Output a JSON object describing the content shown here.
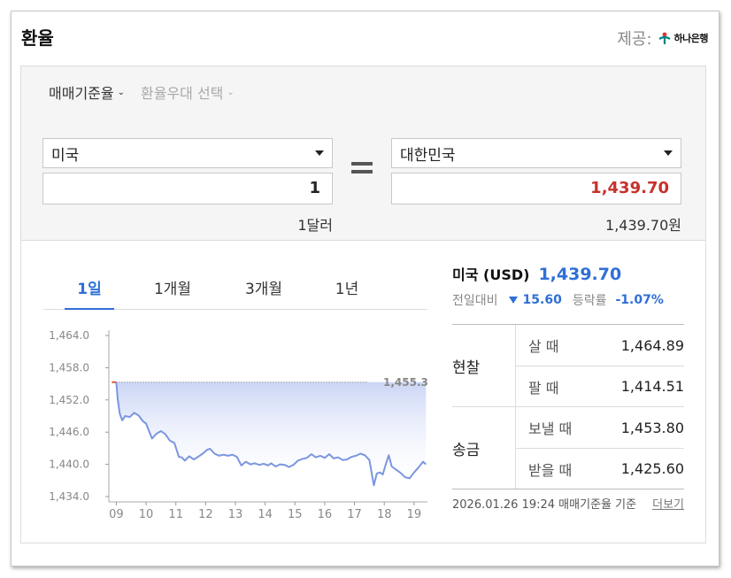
{
  "header": {
    "title": "환율",
    "provider_label": "제공:",
    "provider_name": "하나은행"
  },
  "filters": [
    {
      "label": "매매기준율",
      "active": true
    },
    {
      "label": "환율우대 선택",
      "active": false
    }
  ],
  "converter": {
    "from_country": "미국",
    "from_amount": "1",
    "from_unit_text": "1달러",
    "to_country": "대한민국",
    "to_amount": "1,439.70",
    "to_unit_text": "1,439.70원"
  },
  "tabs": [
    {
      "label": "1일",
      "active": true
    },
    {
      "label": "1개월",
      "active": false
    },
    {
      "label": "3개월",
      "active": false
    },
    {
      "label": "1년",
      "active": false
    }
  ],
  "current": {
    "name": "미국 (USD)",
    "value": "1,439.70",
    "prev_label": "전일대비",
    "change": "15.60",
    "rate_label": "등락률",
    "rate": "-1.07%"
  },
  "rates": [
    {
      "group": "현찰",
      "rows": [
        {
          "label": "살 때",
          "value": "1,464.89"
        },
        {
          "label": "팔 때",
          "value": "1,414.51"
        }
      ]
    },
    {
      "group": "송금",
      "rows": [
        {
          "label": "보낼 때",
          "value": "1,453.80"
        },
        {
          "label": "받을 때",
          "value": "1,425.60"
        }
      ]
    }
  ],
  "footer": {
    "timestamp": "2026.01.26 19:24",
    "basis": "매매기준율 기준",
    "more_label": "더보기"
  },
  "chart_data": {
    "type": "area",
    "ylim": [
      1434.0,
      1464.0
    ],
    "y_ticks": [
      "1,464.0",
      "1,458.0",
      "1,452.0",
      "1,446.0",
      "1,440.0",
      "1,434.0"
    ],
    "x_ticks": [
      "09",
      "10",
      "11",
      "12",
      "13",
      "14",
      "15",
      "16",
      "17",
      "18",
      "19"
    ],
    "reference_label": "1,455.3",
    "reference_value": 1455.3,
    "colors": {
      "line": "#7b96e0",
      "fill_top": "#c8d3f5",
      "pre_open": "#e0533c",
      "reference": "#777777"
    },
    "series": [
      {
        "points": [
          [
            8.85,
            1455.3
          ],
          [
            9.0,
            1455.3
          ],
          [
            9.05,
            1452.0
          ],
          [
            9.12,
            1449.4
          ],
          [
            9.2,
            1448.2
          ],
          [
            9.3,
            1449.0
          ],
          [
            9.45,
            1448.8
          ],
          [
            9.6,
            1449.6
          ],
          [
            9.75,
            1449.1
          ],
          [
            9.9,
            1448.0
          ],
          [
            10.0,
            1447.6
          ],
          [
            10.1,
            1446.2
          ],
          [
            10.2,
            1444.8
          ],
          [
            10.35,
            1445.7
          ],
          [
            10.5,
            1446.2
          ],
          [
            10.65,
            1445.6
          ],
          [
            10.8,
            1444.4
          ],
          [
            10.95,
            1444.0
          ],
          [
            11.1,
            1441.4
          ],
          [
            11.2,
            1441.3
          ],
          [
            11.3,
            1440.7
          ],
          [
            11.45,
            1441.5
          ],
          [
            11.6,
            1440.9
          ],
          [
            11.75,
            1441.4
          ],
          [
            11.9,
            1442.0
          ],
          [
            12.05,
            1442.7
          ],
          [
            12.15,
            1442.9
          ],
          [
            12.3,
            1442.0
          ],
          [
            12.45,
            1441.6
          ],
          [
            12.6,
            1441.8
          ],
          [
            12.75,
            1441.6
          ],
          [
            12.9,
            1441.8
          ],
          [
            13.05,
            1441.4
          ],
          [
            13.2,
            1439.8
          ],
          [
            13.35,
            1440.5
          ],
          [
            13.5,
            1440.0
          ],
          [
            13.65,
            1440.2
          ],
          [
            13.8,
            1439.9
          ],
          [
            13.95,
            1440.1
          ],
          [
            14.1,
            1439.8
          ],
          [
            14.2,
            1440.2
          ],
          [
            14.35,
            1439.6
          ],
          [
            14.5,
            1440.0
          ],
          [
            14.65,
            1439.9
          ],
          [
            14.8,
            1439.5
          ],
          [
            14.95,
            1439.9
          ],
          [
            15.1,
            1440.7
          ],
          [
            15.25,
            1441.0
          ],
          [
            15.4,
            1441.2
          ],
          [
            15.55,
            1441.9
          ],
          [
            15.7,
            1441.3
          ],
          [
            15.85,
            1441.6
          ],
          [
            16.0,
            1441.2
          ],
          [
            16.15,
            1441.9
          ],
          [
            16.3,
            1441.1
          ],
          [
            16.45,
            1441.3
          ],
          [
            16.6,
            1440.8
          ],
          [
            16.75,
            1440.9
          ],
          [
            16.9,
            1441.4
          ],
          [
            17.05,
            1441.6
          ],
          [
            17.2,
            1442.0
          ],
          [
            17.35,
            1441.7
          ],
          [
            17.5,
            1440.8
          ],
          [
            17.65,
            1436.1
          ],
          [
            17.75,
            1438.3
          ],
          [
            17.85,
            1438.5
          ],
          [
            17.95,
            1438.1
          ],
          [
            18.05,
            1440.0
          ],
          [
            18.15,
            1441.7
          ],
          [
            18.25,
            1439.6
          ],
          [
            18.4,
            1439.0
          ],
          [
            18.55,
            1438.4
          ],
          [
            18.7,
            1437.6
          ],
          [
            18.85,
            1437.4
          ],
          [
            19.0,
            1438.5
          ],
          [
            19.15,
            1439.4
          ],
          [
            19.3,
            1440.5
          ],
          [
            19.4,
            1440.0
          ]
        ]
      }
    ]
  }
}
